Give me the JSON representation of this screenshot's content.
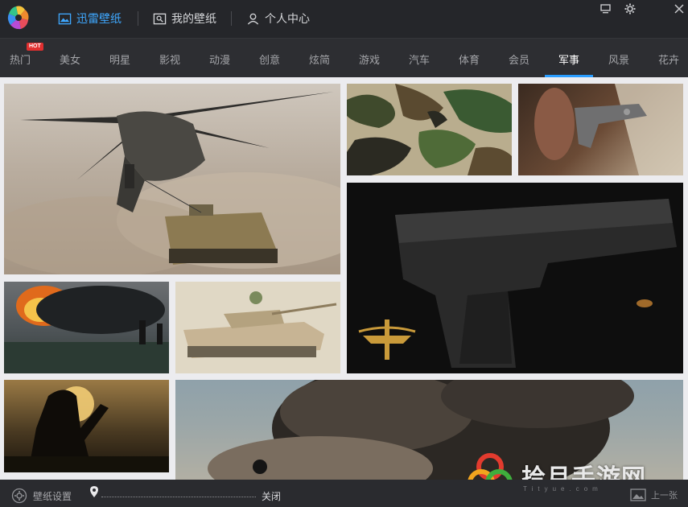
{
  "header": {
    "nav": [
      {
        "label": "迅雷壁纸",
        "icon": "image-icon",
        "active": true
      },
      {
        "label": "我的壁纸",
        "icon": "my-wallpaper-icon",
        "active": false
      },
      {
        "label": "个人中心",
        "icon": "user-icon",
        "active": false
      }
    ],
    "window_buttons": [
      "message-icon",
      "settings-icon",
      "close-icon"
    ]
  },
  "categories": {
    "items": [
      "热门",
      "美女",
      "明星",
      "影视",
      "动漫",
      "创意",
      "炫简",
      "游戏",
      "汽车",
      "体育",
      "会员",
      "军事",
      "风景",
      "花卉"
    ],
    "active": "军事",
    "hot_badge": "HOT"
  },
  "wallpapers": [
    {
      "name": "helicopter-and-vehicle"
    },
    {
      "name": "camouflage-pattern"
    },
    {
      "name": "pistol-on-magazine"
    },
    {
      "name": "black-handgun-navy-seal"
    },
    {
      "name": "oil-fire-soldiers"
    },
    {
      "name": "desert-tank"
    },
    {
      "name": "soldier-silhouette-sunset"
    },
    {
      "name": "smoke-explosion-soldier"
    }
  ],
  "footer": {
    "settings_label": "壁纸设置",
    "close_label": "关闭",
    "prev_label": "上一张"
  },
  "watermark": {
    "text": "拾月手游网",
    "sub": "Tityue.com"
  },
  "colors": {
    "accent": "#3fa8ff",
    "underline": "#2a9dff",
    "hot": "#e02f2f",
    "titlebar": "#25262a"
  }
}
